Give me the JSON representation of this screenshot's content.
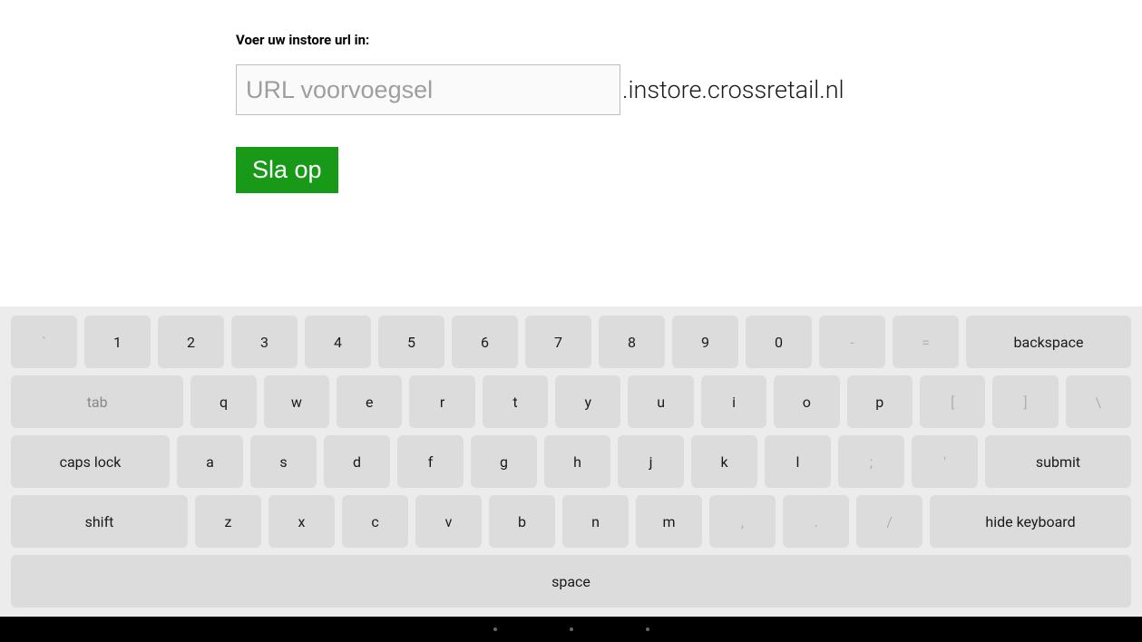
{
  "form": {
    "label": "Voer uw instore url in:",
    "input_placeholder": "URL voorvoegsel",
    "input_value": "",
    "suffix": ".instore.crossretail.nl",
    "save_label": "Sla op"
  },
  "keyboard": {
    "row1": [
      "`",
      "1",
      "2",
      "3",
      "4",
      "5",
      "6",
      "7",
      "8",
      "9",
      "0",
      "-",
      "=",
      "backspace"
    ],
    "row2": [
      "tab",
      "q",
      "w",
      "e",
      "r",
      "t",
      "y",
      "u",
      "i",
      "o",
      "p",
      "[",
      "]",
      "\\"
    ],
    "row3": [
      "caps lock",
      "a",
      "s",
      "d",
      "f",
      "g",
      "h",
      "j",
      "k",
      "l",
      ";",
      "'",
      "submit"
    ],
    "row4": [
      "shift",
      "z",
      "x",
      "c",
      "v",
      "b",
      "n",
      "m",
      ",",
      ".",
      "/",
      "hide keyboard"
    ],
    "row5": [
      "space"
    ]
  }
}
